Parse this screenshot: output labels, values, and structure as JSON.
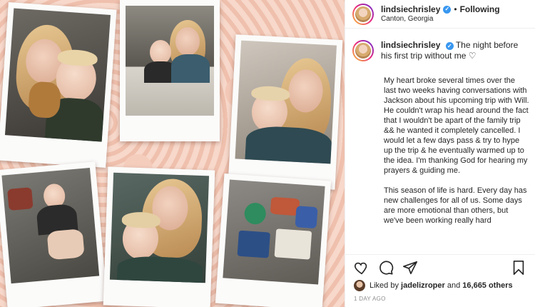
{
  "post": {
    "author": {
      "username": "lindsiechrisley",
      "verified": true,
      "follow_status": "Following",
      "location": "Canton, Georgia"
    },
    "caption": {
      "first_line": "The night before his first trip without me",
      "first_line_emoji": "♡",
      "paragraphs": [
        "My heart broke several times over the last two weeks having conversations with Jackson about his upcoming trip with Will. He couldn't wrap his head around the fact that I wouldn't be apart of the family trip && he wanted it completely cancelled. I would let a few days pass & try to hype up the trip & he eventually warmed up to the idea. I'm thanking God for hearing my prayers & guiding me.",
        "This season of life is hard. Every day has new challenges for all of us. Some days are more emotional than others, but we've been working really hard"
      ]
    },
    "likes": {
      "prefix": "Liked by",
      "liker": "jadelizroper",
      "conjunction": "and",
      "count_text": "16,665 others"
    },
    "time_ago": "1 DAY AGO"
  },
  "icons": {
    "like": "heart-icon",
    "comment": "comment-icon",
    "share": "paper-plane-icon",
    "save": "bookmark-icon",
    "verified": "verified-badge-icon"
  },
  "colors": {
    "verified_blue": "#3897f0",
    "text": "#262626",
    "muted": "#8e8e8e"
  }
}
